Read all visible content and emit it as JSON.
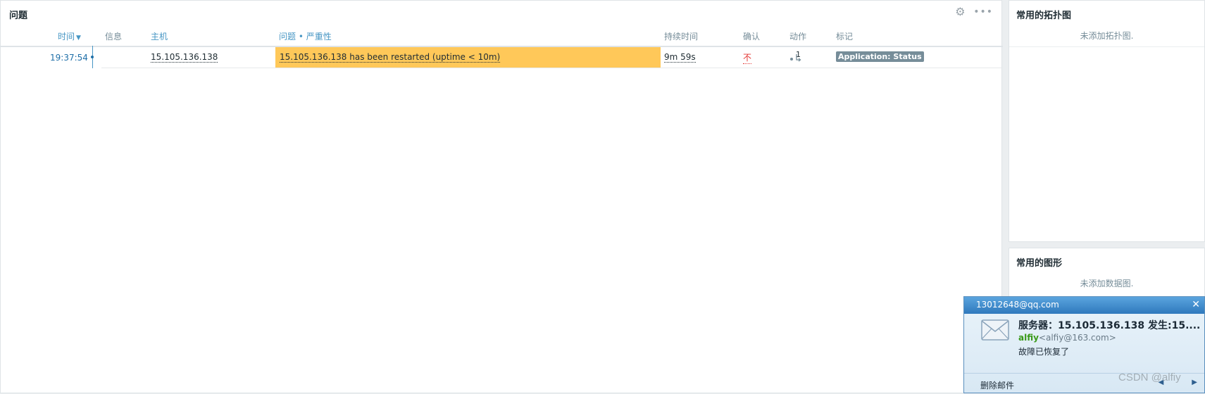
{
  "problems_widget": {
    "title": "问题",
    "columns": {
      "time": "时间",
      "info": "信息",
      "host": "主机",
      "problem_severity": "问题 • 严重性",
      "duration": "持续时间",
      "ack": "确认",
      "actions": "动作",
      "tags": "标记"
    },
    "rows": [
      {
        "time": "19:37:54",
        "host": "15.105.136.138",
        "problem": "15.105.136.138 has been restarted (uptime < 10m)",
        "duration": "9m 59s",
        "ack": "不",
        "actions_count": "1",
        "tag": "Application: Status",
        "severity_color": "#ffc859"
      }
    ]
  },
  "maps_widget": {
    "title": "常用的拓扑图",
    "empty_text": "未添加拓扑图."
  },
  "graphs_widget": {
    "title": "常用的图形",
    "empty_text": "未添加数据图."
  },
  "notification": {
    "account": "13012648@qq.com",
    "subject": "服务器：15.105.136.138 发生:15....",
    "sender_name": "alfiy",
    "sender_email": "<alfiy@163.com>",
    "body": "故障已恢复了",
    "delete_label": "删除邮件"
  },
  "watermark": "CSDN @alfiy"
}
